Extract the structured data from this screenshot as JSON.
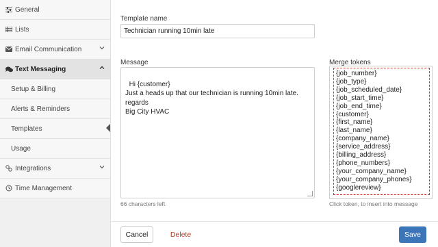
{
  "sidebar": {
    "items": [
      {
        "label": "General",
        "icon": "sliders-icon"
      },
      {
        "label": "Lists",
        "icon": "list-icon"
      },
      {
        "label": "Email Communication",
        "icon": "envelope-icon",
        "chevron": "chevron-down-icon"
      },
      {
        "label": "Text Messaging",
        "icon": "chat-icon",
        "chevron": "chevron-up-icon"
      },
      {
        "label": "Setup & Billing"
      },
      {
        "label": "Alerts & Reminders"
      },
      {
        "label": "Templates"
      },
      {
        "label": "Usage"
      },
      {
        "label": "Integrations",
        "icon": "integrations-icon",
        "chevron": "chevron-down-icon"
      },
      {
        "label": "Time Management",
        "icon": "clock-icon"
      }
    ],
    "active_section": "Text Messaging",
    "selected_item": "Templates"
  },
  "form": {
    "template_name_label": "Template name",
    "template_name_value": "Technician running 10min late",
    "message_label": "Message",
    "message_value": "Hi {customer}\nJust a heads up that our technician is running 10min late.\nregards\nBig City HVAC",
    "chars_left": "66 characters left",
    "merge_tokens_label": "Merge tokens",
    "merge_tokens": [
      "{job_number}",
      "{job_type}",
      "{job_scheduled_date}",
      "{job_start_time}",
      "{job_end_time}",
      "{customer}",
      "{first_name}",
      "{last_name}",
      "{company_name}",
      "{service_address}",
      "{billing_address}",
      "{phone_numbers}",
      "{your_company_name}",
      "{your_company_phones}",
      "{googlereview}"
    ],
    "tokens_hint": "Click token, to insert into message"
  },
  "actions": {
    "cancel_label": "Cancel",
    "delete_label": "Delete",
    "save_label": "Save"
  },
  "colors": {
    "save_button": "#3c76b8",
    "delete_text": "#b5361f",
    "token_border": "#d9342b"
  }
}
